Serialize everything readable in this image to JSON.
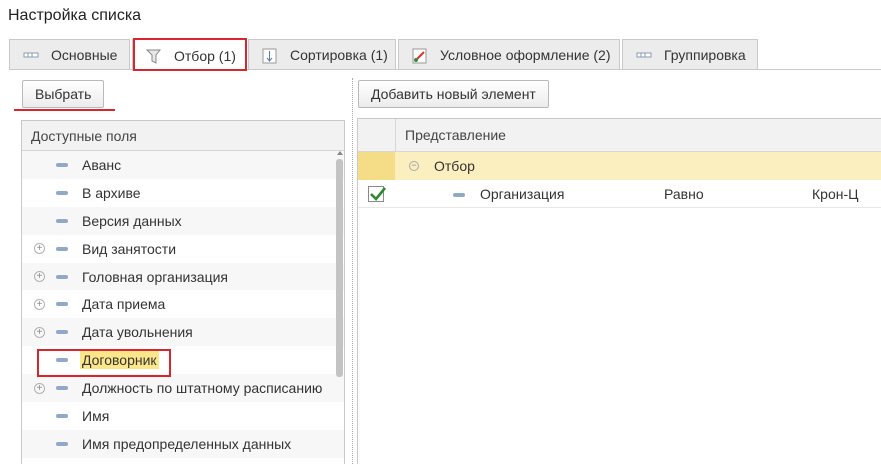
{
  "window": {
    "title": "Настройка списка"
  },
  "tabs": [
    {
      "label": "Основные",
      "icon": "fields-icon"
    },
    {
      "label": "Отбор (1)",
      "icon": "filter-icon"
    },
    {
      "label": "Сортировка (1)",
      "icon": "sort-icon"
    },
    {
      "label": "Условное оформление (2)",
      "icon": "conditional-format-icon"
    },
    {
      "label": "Группировка",
      "icon": "grouping-icon"
    }
  ],
  "toolbar": {
    "select_label": "Выбрать",
    "add_label": "Добавить новый элемент"
  },
  "available_fields": {
    "header": "Доступные поля",
    "items": [
      {
        "label": "Аванс",
        "expandable": false
      },
      {
        "label": "В архиве",
        "expandable": false
      },
      {
        "label": "Версия данных",
        "expandable": false
      },
      {
        "label": "Вид занятости",
        "expandable": true
      },
      {
        "label": "Головная организация",
        "expandable": true
      },
      {
        "label": "Дата приема",
        "expandable": true
      },
      {
        "label": "Дата увольнения",
        "expandable": true
      },
      {
        "label": "Договорник",
        "expandable": false,
        "selected": true
      },
      {
        "label": "Должность по штатному расписанию",
        "expandable": true
      },
      {
        "label": "Имя",
        "expandable": false
      },
      {
        "label": "Имя предопределенных данных",
        "expandable": false
      }
    ]
  },
  "filter_table": {
    "header": "Представление",
    "group_label": "Отбор",
    "conditions": [
      {
        "checked": true,
        "field": "Организация",
        "comparison": "Равно",
        "value": "Крон-Ц"
      }
    ]
  },
  "colors": {
    "highlight": "#d9262e",
    "group_row": "#fbeebf",
    "selected_field": "#fbe78a"
  }
}
